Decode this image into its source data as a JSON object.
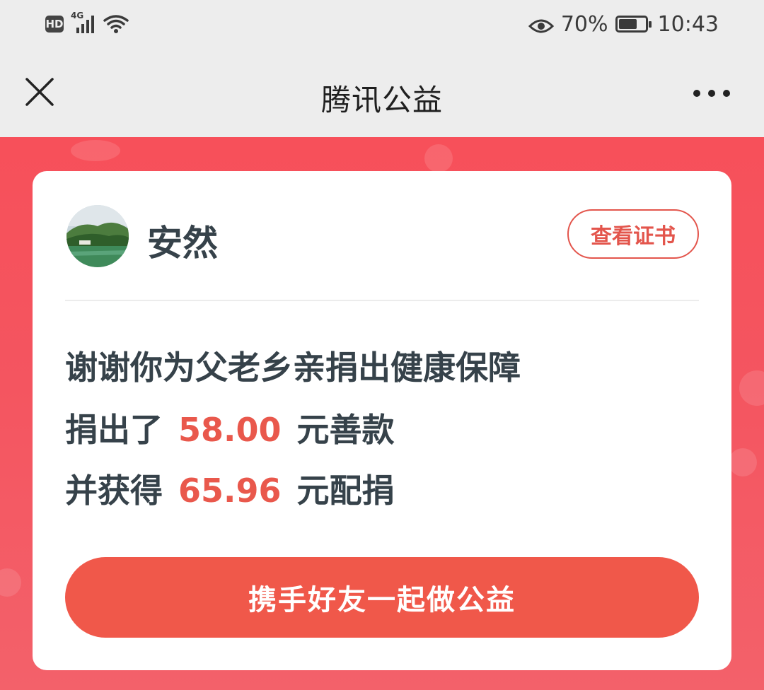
{
  "status_bar": {
    "hd_badge": "HD",
    "network": "4G",
    "battery_percent": "70%",
    "battery_level": 0.7,
    "time": "10:43",
    "icons": [
      "signal-icon",
      "wifi-icon",
      "eye-icon",
      "battery-icon"
    ]
  },
  "titlebar": {
    "title": "腾讯公益",
    "close_icon": "close-icon",
    "more_icon": "more-icon"
  },
  "card": {
    "user_name": "安然",
    "certificate_button": "查看证书",
    "thanks_text": "谢谢你为父老乡亲捐出健康保障",
    "donated_prefix": "捐出了",
    "donated_amount": "58.00",
    "donated_suffix": "元善款",
    "matched_prefix": "并获得",
    "matched_amount": "65.96",
    "matched_suffix": "元配捐",
    "share_button": "携手好友一起做公益"
  },
  "colors": {
    "accent_red": "#f0584a",
    "amount_red": "#e9584c",
    "background_red": "#f4525c",
    "text_dark": "#36424a"
  }
}
